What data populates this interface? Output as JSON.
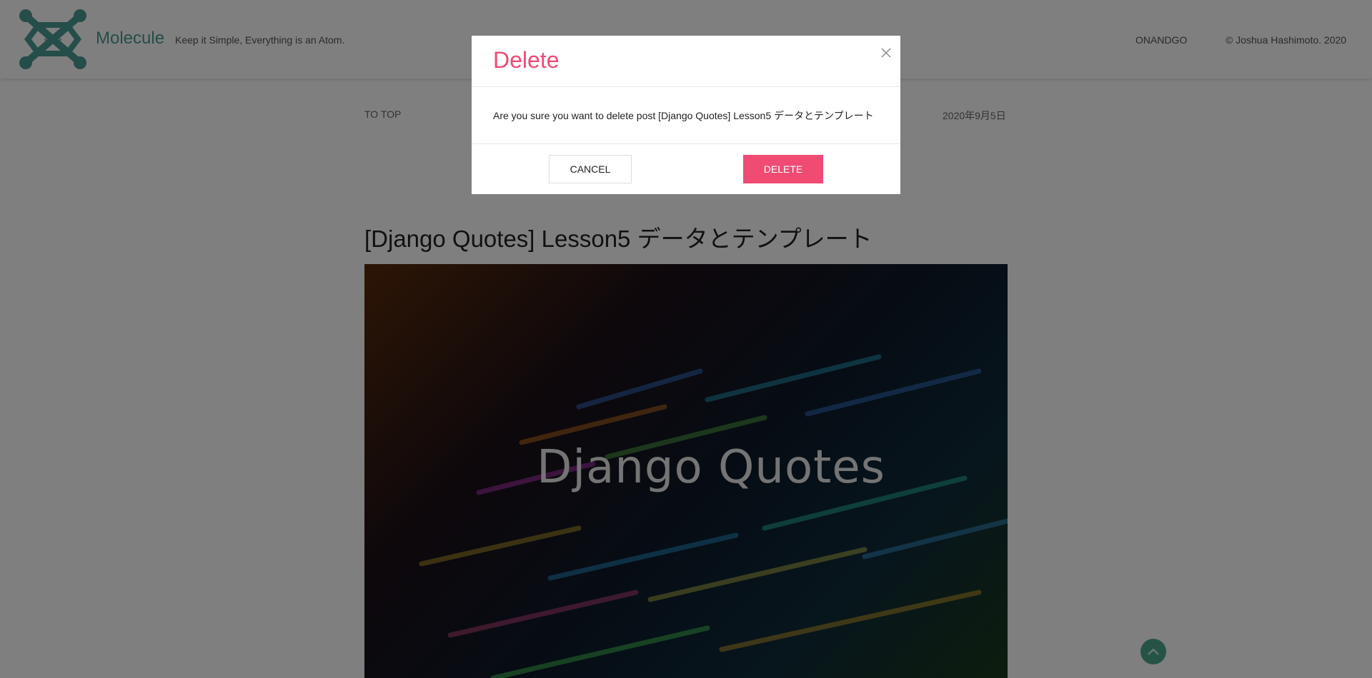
{
  "header": {
    "brand": "Molecule",
    "tagline": "Keep it Simple, Everything is an Atom.",
    "nav_onandgo": "ONANDGO",
    "copyright": "© Joshua Hashimoto. 2020",
    "logo_icon": "molecule-logo-icon",
    "brand_color": "#4a9a92"
  },
  "post": {
    "to_top": "TO TOP",
    "date": "2020年9月5日",
    "title": "[Django Quotes] Lesson5 データとテンプレート",
    "hero_text": "Django Quotes"
  },
  "scroll_top": {
    "icon": "chevron-up-icon",
    "color": "#4aa88f"
  },
  "modal": {
    "title": "Delete",
    "message": "Are you sure you want to delete post [Django Quotes] Lesson5 データとテンプレート",
    "cancel_label": "CANCEL",
    "delete_label": "DELETE",
    "close_icon": "close-icon",
    "accent_color": "#ef4b73"
  }
}
